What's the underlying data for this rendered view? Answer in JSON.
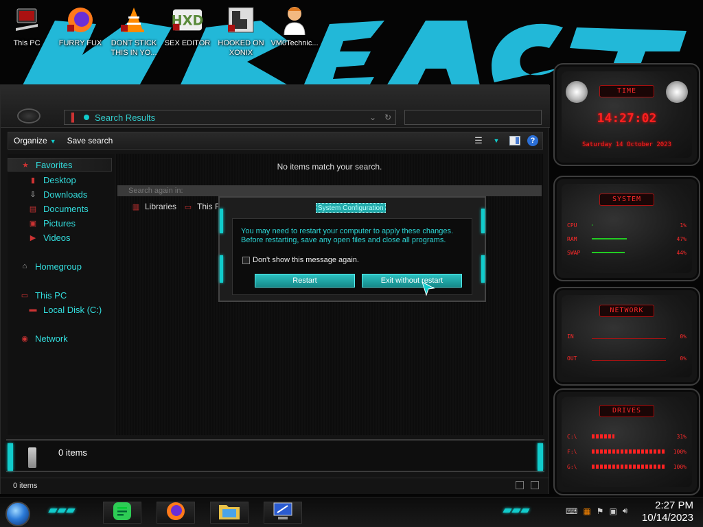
{
  "desktop": {
    "icons": [
      {
        "label": "This PC"
      },
      {
        "label": "FURRY FUX"
      },
      {
        "label": "DONT STICK THIS IN YO..."
      },
      {
        "label": "SEX EDITOR"
      },
      {
        "label": "HOOKED ON XONIX"
      },
      {
        "label": "VM0Technic..."
      }
    ]
  },
  "explorer": {
    "address": "Search Results",
    "toolbar": {
      "organize": "Organize",
      "save_search": "Save search"
    },
    "nav": {
      "favorites": "Favorites",
      "desktop": "Desktop",
      "downloads": "Downloads",
      "documents": "Documents",
      "pictures": "Pictures",
      "videos": "Videos",
      "homegroup": "Homegroup",
      "this_pc": "This PC",
      "local_disk": "Local Disk (C:)",
      "network": "Network"
    },
    "content": {
      "empty_message": "No items match your search.",
      "search_again": "Search again in:",
      "libraries": "Libraries",
      "this_pc": "This PC"
    },
    "details_pane": {
      "count": "0 items"
    },
    "status": {
      "count": "0 items"
    }
  },
  "dialog": {
    "title": "System Configuration",
    "message_line1": "You may need to restart your computer to apply these changes.",
    "message_line2": "Before restarting, save any open files and close all programs.",
    "checkbox_label": "Don't show this message again.",
    "checkbox_checked": false,
    "restart_label": "Restart",
    "exit_label": "Exit without restart"
  },
  "gadgets": {
    "time": {
      "header": "TIME",
      "time": "14:27:02",
      "date": "Saturday 14 October 2023"
    },
    "system": {
      "header": "SYSTEM",
      "rows": [
        {
          "label": "CPU",
          "value": "1%",
          "level": 0.01
        },
        {
          "label": "RAM",
          "value": "47%",
          "level": 0.47
        },
        {
          "label": "SWAP",
          "value": "44%",
          "level": 0.44
        }
      ]
    },
    "network": {
      "header": "NETWORK",
      "rows": [
        {
          "label": "IN",
          "value": "0%"
        },
        {
          "label": "OUT",
          "value": "0%"
        }
      ]
    },
    "drives": {
      "header": "DRIVES",
      "rows": [
        {
          "label": "C:\\",
          "value": "31%",
          "level": 0.31
        },
        {
          "label": "F:\\",
          "value": "100%",
          "level": 1.0
        },
        {
          "label": "G:\\",
          "value": "100%",
          "level": 1.0
        }
      ]
    }
  },
  "taskbar": {
    "time": "2:27 PM",
    "date": "10/14/2023"
  },
  "colors": {
    "accent": "#1cc8c8",
    "gadget_red": "#ff2020"
  }
}
